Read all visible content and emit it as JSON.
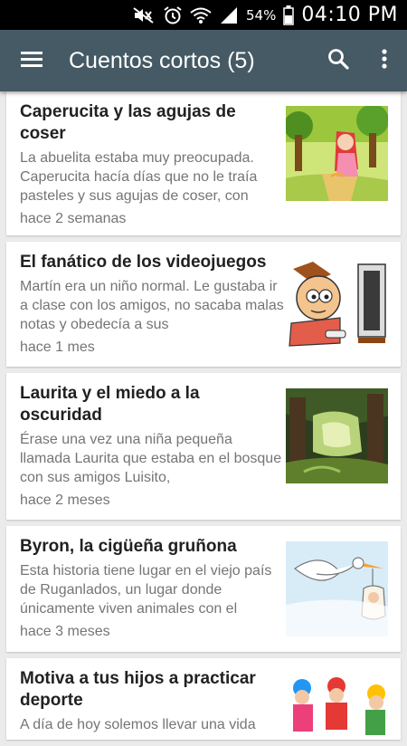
{
  "status_bar": {
    "battery_percent": "54%",
    "time": "04:10 PM",
    "icons": [
      "mute-icon",
      "alarm-icon",
      "wifi-icon",
      "signal-icon",
      "battery-icon"
    ]
  },
  "app_bar": {
    "title": "Cuentos cortos (5)",
    "background_color": "#455a64",
    "icons": [
      "menu-icon",
      "search-icon",
      "more-vert-icon"
    ]
  },
  "stories": [
    {
      "title": "Caperucita y las agujas de coser",
      "excerpt": "La abuelita estaba muy preocupada. Caperucita hacía días que no le traía pasteles y sus agujas de coser, con",
      "date": "hace 2 semanas",
      "thumbnail": "little-red-riding-hood-illustration"
    },
    {
      "title": "El fanático de los videojuegos",
      "excerpt": "Martín era un niño normal. Le gustaba ir a clase con los amigos, no sacaba malas notas y obedecía a sus",
      "date": "hace 1 mes",
      "thumbnail": "boy-playing-videogames-illustration"
    },
    {
      "title": "Laurita y el miedo a la oscuridad",
      "excerpt": "Érase una vez una niña pequeña llamada Laurita que estaba en el bosque con sus amigos Luisito,",
      "date": "hace 2 meses",
      "thumbnail": "dark-forest-illustration"
    },
    {
      "title": "Byron, la cigüeña gruñona",
      "excerpt": "Esta historia tiene lugar en el viejo país de Ruganlados, un lugar donde únicamente viven animales con el",
      "date": "hace 3 meses",
      "thumbnail": "stork-carrying-bundle-illustration"
    },
    {
      "title": "Motiva a tus hijos a practicar deporte",
      "excerpt": "A día de hoy solemos llevar una vida",
      "date": "",
      "thumbnail": "kids-cycling-photo"
    }
  ]
}
